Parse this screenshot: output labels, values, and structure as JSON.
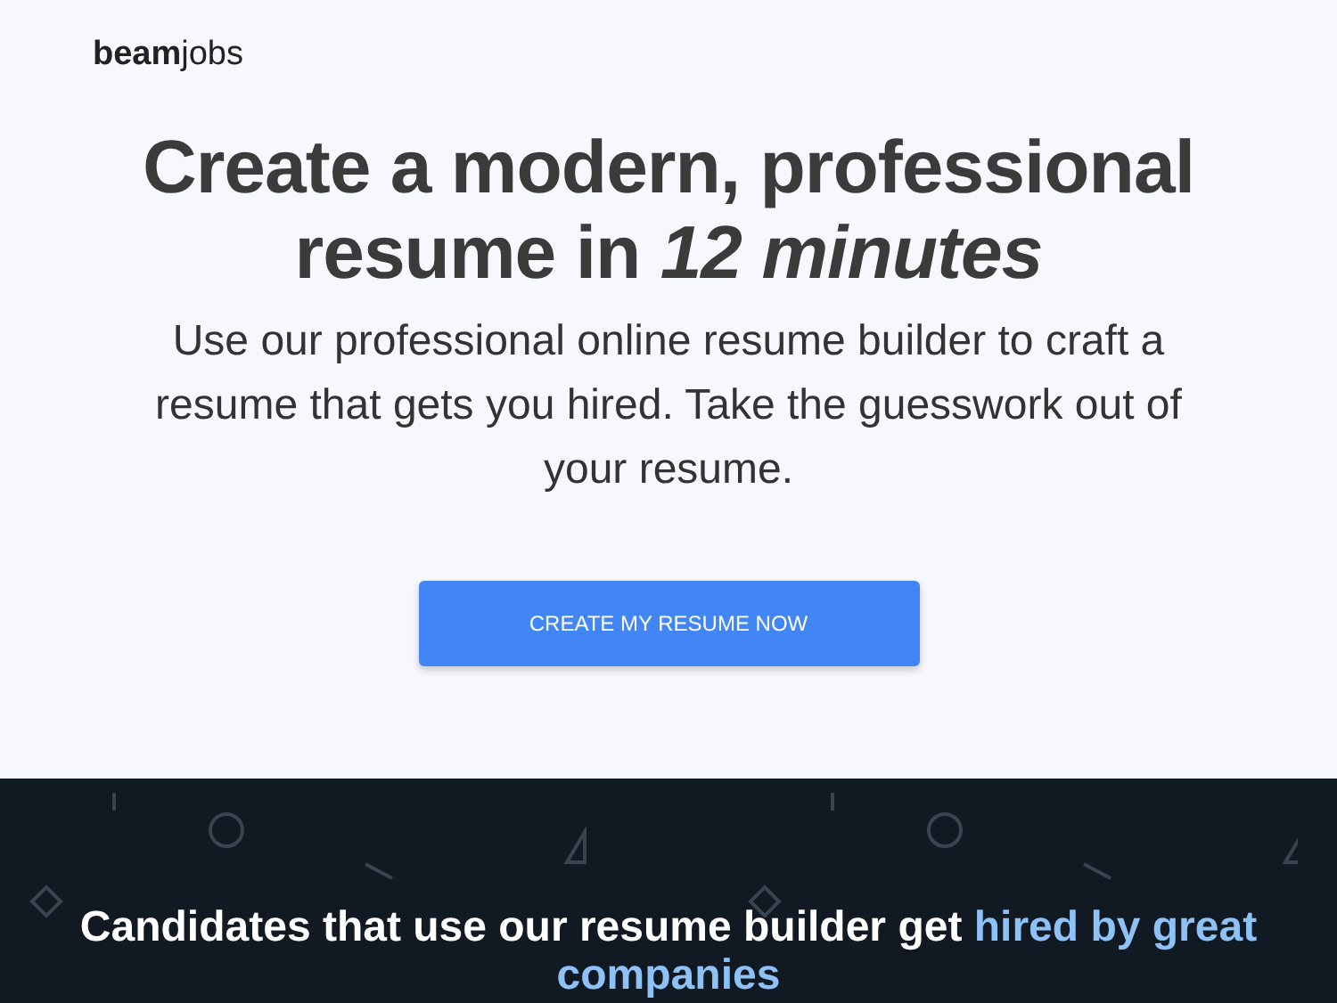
{
  "logo": "**beam**jobs",
  "hero": {
    "title": "Create a modern, professional resume in *12 minutes*",
    "subtitle": "Use our professional online resume builder to craft a resume that gets you hired. Take the guesswork out of your resume.",
    "button": "CREATE MY RESUME NOW"
  },
  "companies_section": {
    "heading": "Candidates that use our resume builder get",
    "highlight": "hired by great companies"
  }
}
